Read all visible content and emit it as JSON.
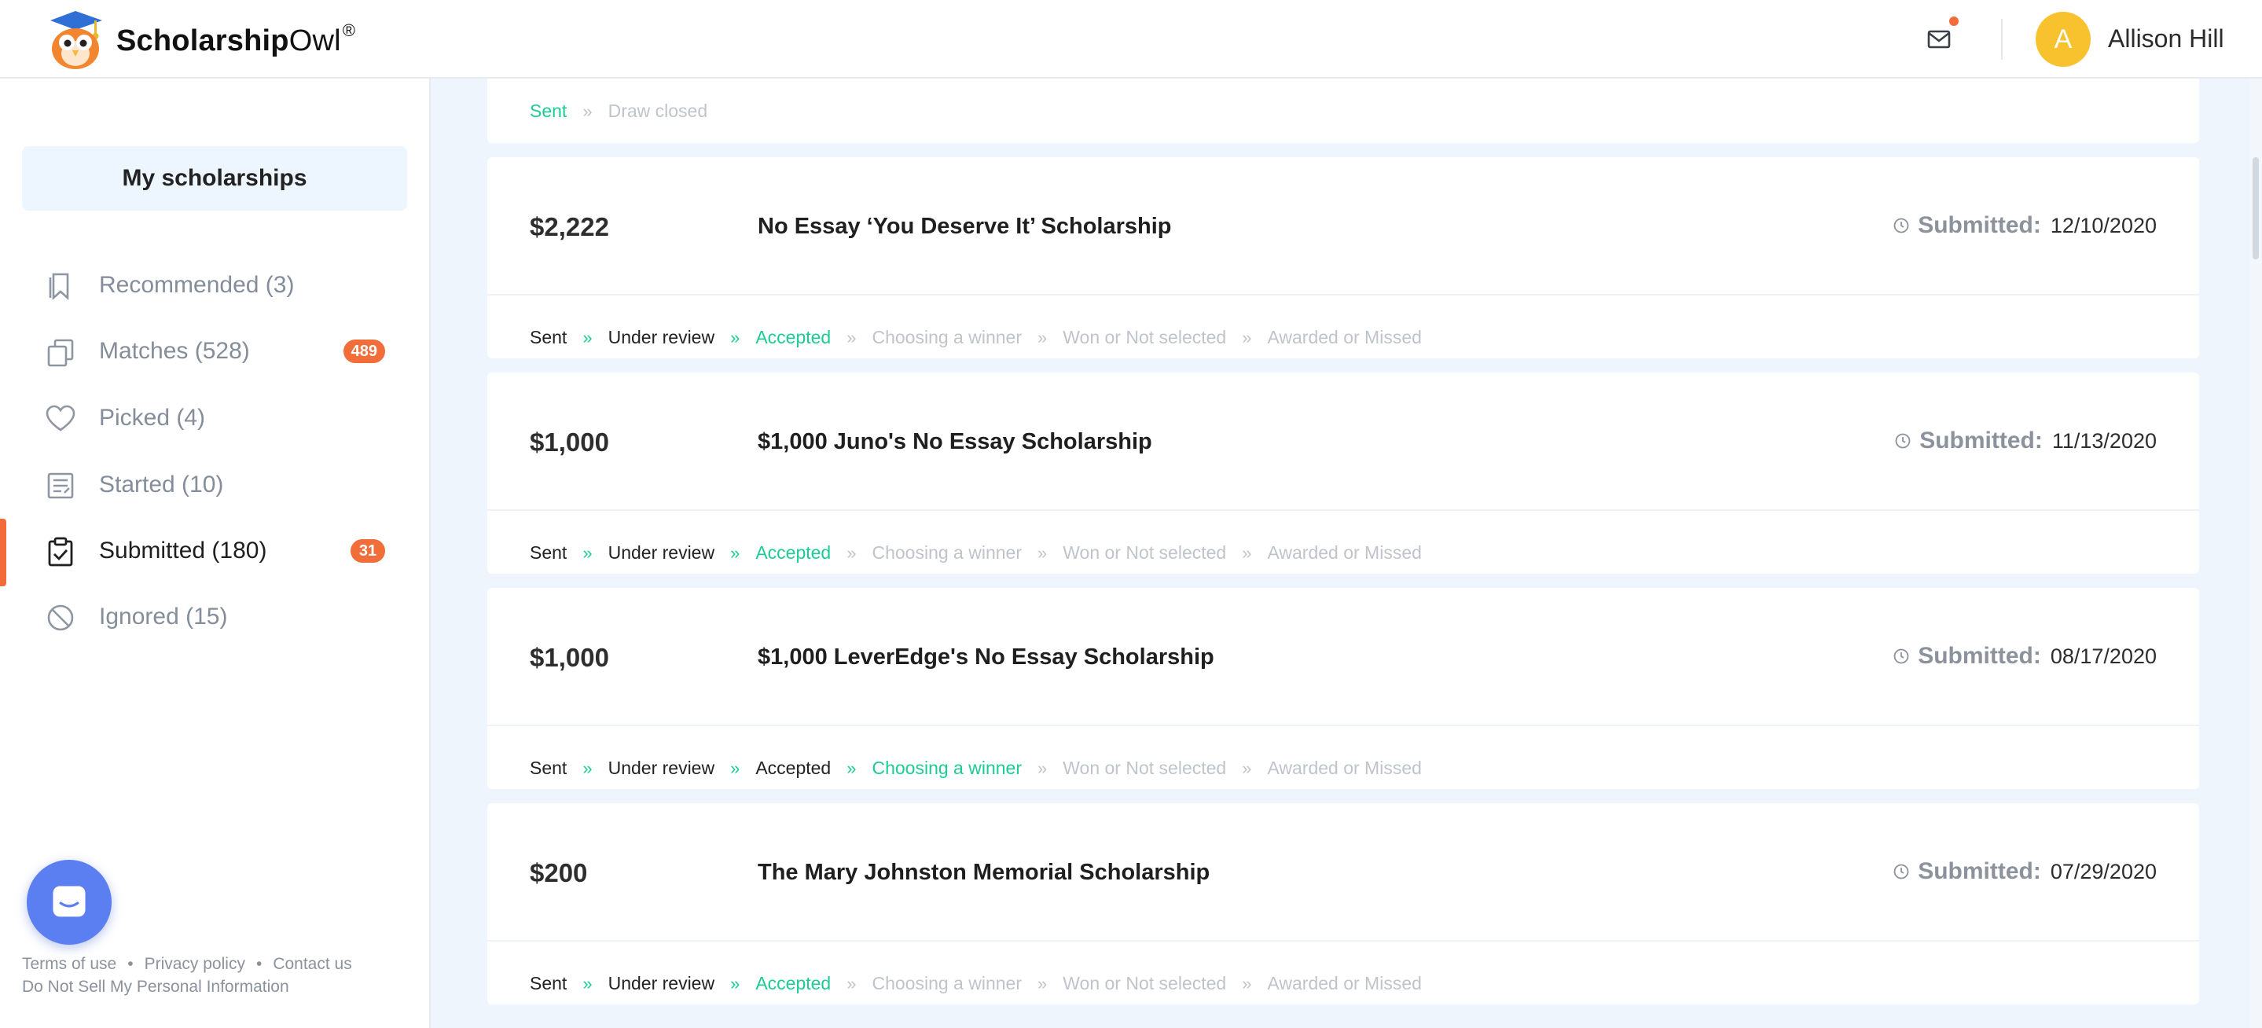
{
  "header": {
    "logo_bold": "Scholarship",
    "logo_rest": "Owl",
    "logo_reg": "®",
    "avatar_initial": "A",
    "user_name": "Allison Hill",
    "accent_color": "#f26b3a"
  },
  "sidebar": {
    "heading": "My scholarships",
    "items": [
      {
        "label": "Recommended  (3)",
        "icon": "bookmark-icon"
      },
      {
        "label": "Matches  (528)",
        "icon": "copy-icon",
        "badge": "489"
      },
      {
        "label": "Picked  (4)",
        "icon": "heart-icon"
      },
      {
        "label": "Started  (10)",
        "icon": "document-icon"
      },
      {
        "label": "Submitted  (180)",
        "icon": "clipboard-check-icon",
        "badge": "31",
        "active": true
      },
      {
        "label": "Ignored  (15)",
        "icon": "block-icon"
      }
    ],
    "footer": {
      "terms": "Terms of use",
      "privacy": "Privacy policy",
      "contact": "Contact us",
      "do_not_sell": "Do Not Sell My Personal Information",
      "separator": "•"
    }
  },
  "status_steps": {
    "sent": "Sent",
    "under_review": "Under review",
    "accepted": "Accepted",
    "choosing": "Choosing a winner",
    "won": "Won or Not selected",
    "awarded": "Awarded or Missed",
    "draw_closed": "Draw closed",
    "separator": "»"
  },
  "partial_card": {
    "steps": [
      "Sent",
      "Draw closed"
    ]
  },
  "submitted_label": "Submitted:",
  "cards": [
    {
      "amount": "$2,222",
      "title": "No Essay ‘You Deserve It’ Scholarship",
      "date": "12/10/2020",
      "current_step": "Accepted"
    },
    {
      "amount": "$1,000",
      "title": "$1,000 Juno's No Essay Scholarship",
      "date": "11/13/2020",
      "current_step": "Accepted"
    },
    {
      "amount": "$1,000",
      "title": "$1,000 LeverEdge's No Essay Scholarship",
      "date": "08/17/2020",
      "current_step": "Choosing a winner"
    },
    {
      "amount": "$200",
      "title": "The Mary Johnston Memorial Scholarship",
      "date": "07/29/2020",
      "current_step": "Accepted"
    }
  ]
}
